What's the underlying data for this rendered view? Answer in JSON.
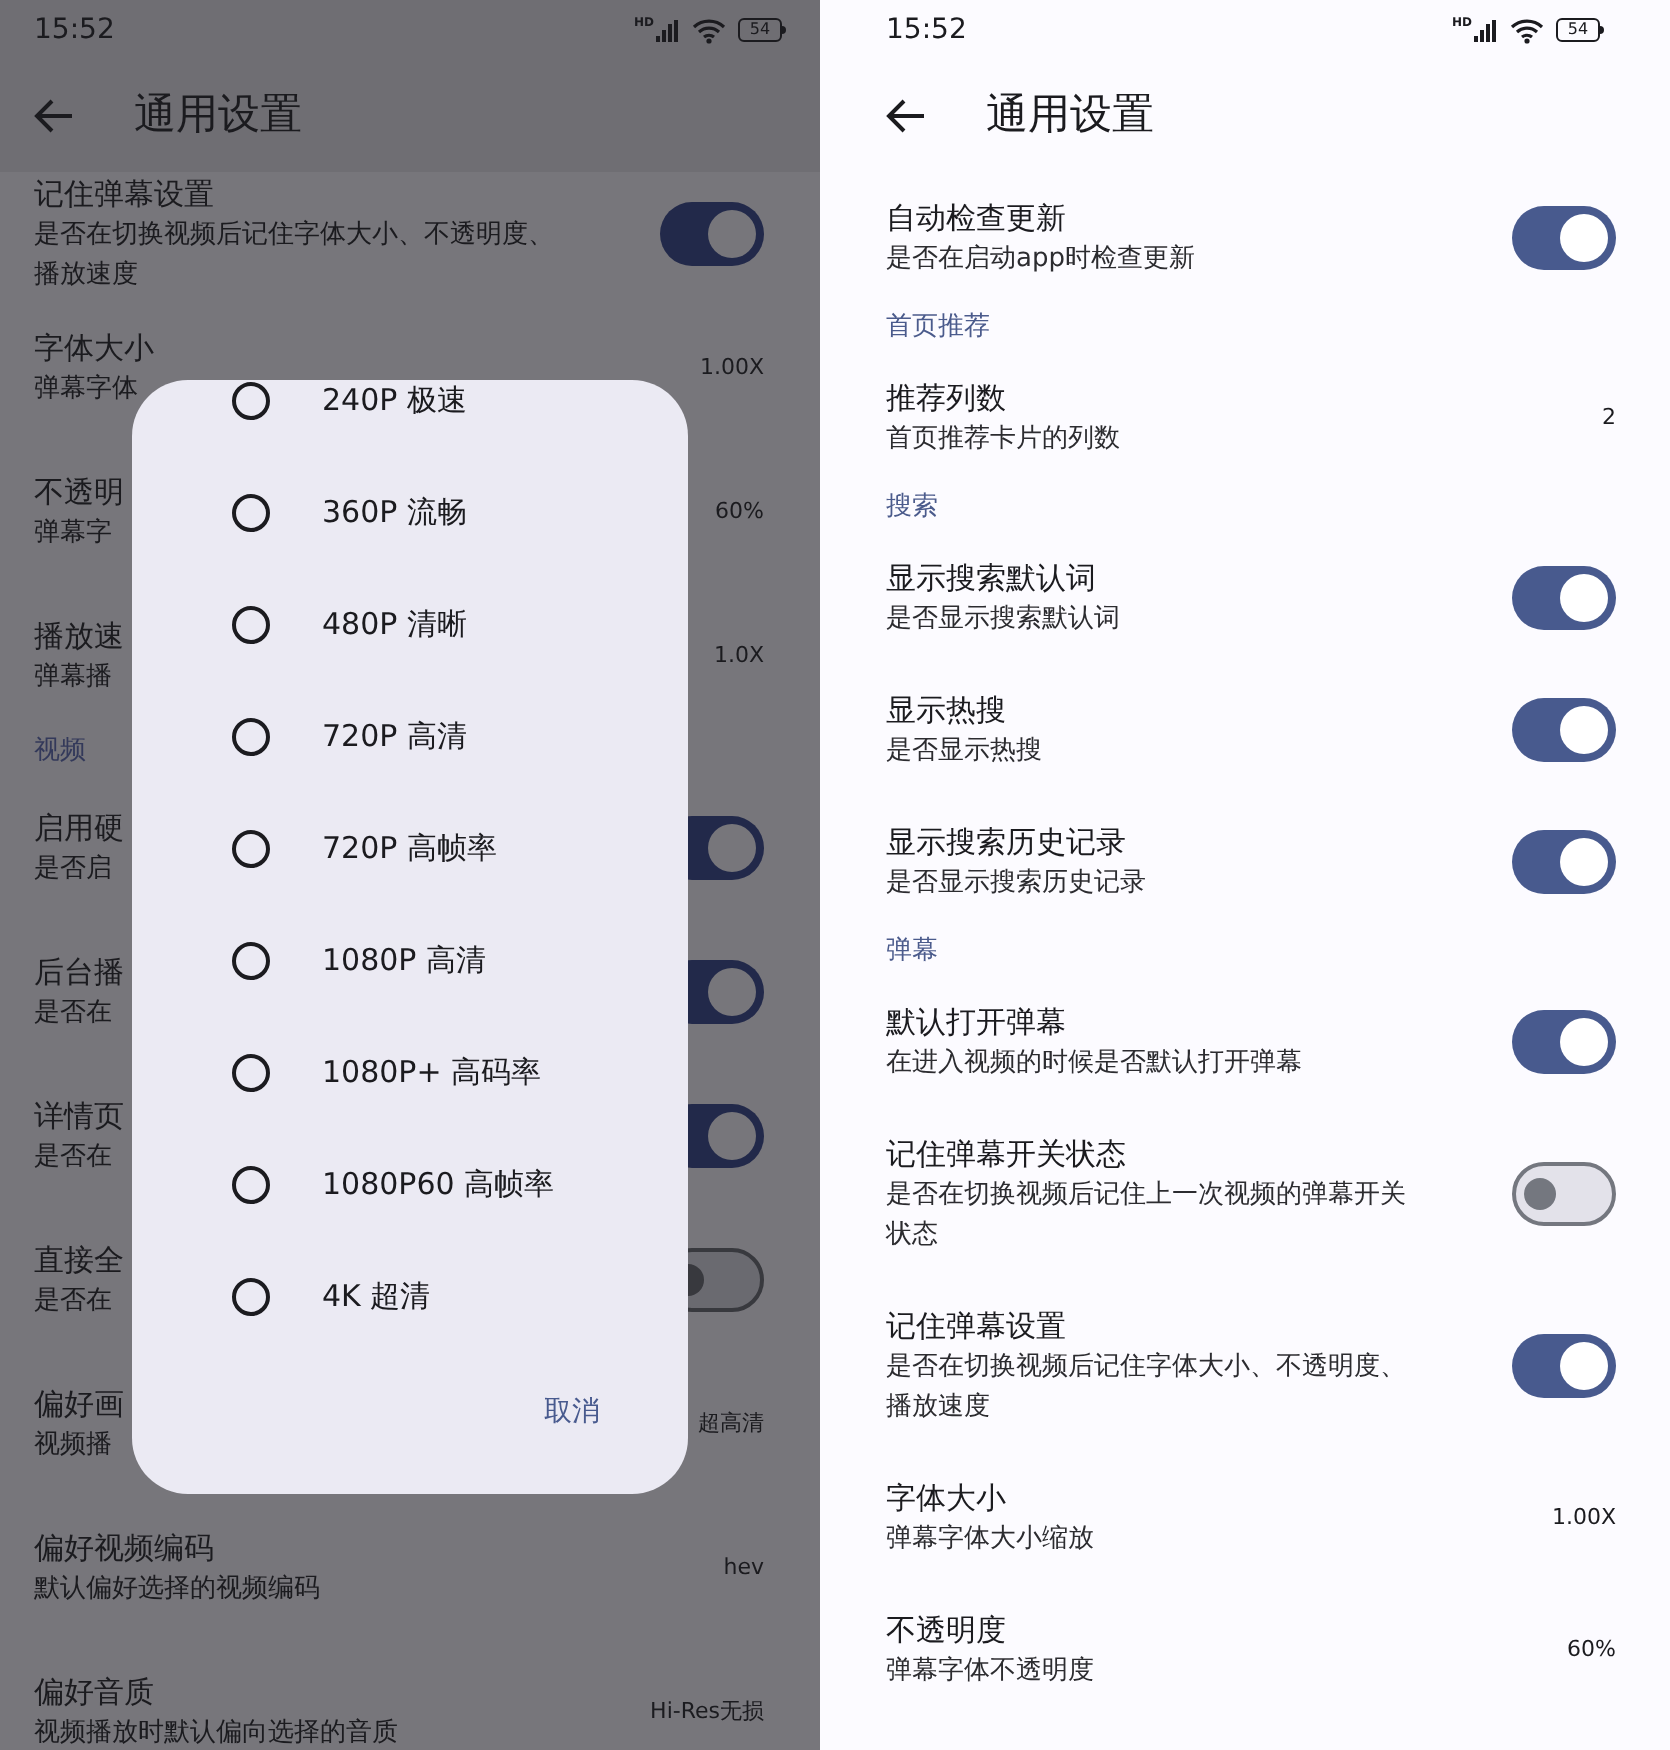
{
  "left_screen": {
    "status_bar": {
      "time": "15:52",
      "signal_label": "HD",
      "battery": "54"
    },
    "title": "通用设置",
    "items": [
      {
        "kind": "toggle",
        "title": "记住弹幕设置",
        "subtitle": "是否在切换视频后记住字体大小、不透明度、播放速度",
        "on": true
      },
      {
        "kind": "value",
        "title": "字体大小",
        "subtitle": "弹幕字体",
        "value": "1.00X"
      },
      {
        "kind": "value",
        "title": "不透明",
        "subtitle": "弹幕字",
        "value": "60%"
      },
      {
        "kind": "value",
        "title": "播放速",
        "subtitle": "弹幕播",
        "value": "1.0X"
      },
      {
        "kind": "section",
        "title": "视频"
      },
      {
        "kind": "toggle",
        "title": "启用硬",
        "subtitle": "是否启",
        "on": true
      },
      {
        "kind": "toggle",
        "title": "后台播",
        "subtitle": "是否在",
        "on": true
      },
      {
        "kind": "toggle",
        "title": "详情页",
        "subtitle": "是否在",
        "on": true
      },
      {
        "kind": "toggle",
        "title": "直接全",
        "subtitle": "是否在",
        "on": false
      },
      {
        "kind": "value",
        "title": "偏好画",
        "subtitle": "视频播",
        "value": "超高清"
      },
      {
        "kind": "value",
        "title": "偏好视频编码",
        "subtitle": "默认偏好选择的视频编码",
        "value": "hev"
      },
      {
        "kind": "value",
        "title": "偏好音质",
        "subtitle": "视频播放时默认偏向选择的音质",
        "value": "Hi-Res无损"
      }
    ],
    "dialog": {
      "options": [
        {
          "label": "240P 极速",
          "selected": false
        },
        {
          "label": "360P 流畅",
          "selected": false
        },
        {
          "label": "480P 清晰",
          "selected": false
        },
        {
          "label": "720P 高清",
          "selected": false
        },
        {
          "label": "720P 高帧率",
          "selected": false
        },
        {
          "label": "1080P 高清",
          "selected": false
        },
        {
          "label": "1080P+ 高码率",
          "selected": false
        },
        {
          "label": "1080P60 高帧率",
          "selected": false
        },
        {
          "label": "4K 超清",
          "selected": false
        }
      ],
      "cancel": "取消"
    }
  },
  "right_screen": {
    "status_bar": {
      "time": "15:52",
      "signal_label": "HD",
      "battery": "54"
    },
    "title": "通用设置",
    "items": [
      {
        "kind": "toggle",
        "title": "自动检查更新",
        "subtitle": "是否在启动app时检查更新",
        "on": true
      },
      {
        "kind": "section",
        "title": "首页推荐"
      },
      {
        "kind": "value",
        "title": "推荐列数",
        "subtitle": "首页推荐卡片的列数",
        "value": "2"
      },
      {
        "kind": "section",
        "title": "搜索"
      },
      {
        "kind": "toggle",
        "title": "显示搜索默认词",
        "subtitle": "是否显示搜索默认词",
        "on": true
      },
      {
        "kind": "toggle",
        "title": "显示热搜",
        "subtitle": "是否显示热搜",
        "on": true
      },
      {
        "kind": "toggle",
        "title": "显示搜索历史记录",
        "subtitle": "是否显示搜索历史记录",
        "on": true
      },
      {
        "kind": "section",
        "title": "弹幕"
      },
      {
        "kind": "toggle",
        "title": "默认打开弹幕",
        "subtitle": "在进入视频的时候是否默认打开弹幕",
        "on": true
      },
      {
        "kind": "toggle",
        "title": "记住弹幕开关状态",
        "subtitle": "是否在切换视频后记住上一次视频的弹幕开关状态",
        "on": false
      },
      {
        "kind": "toggle",
        "title": "记住弹幕设置",
        "subtitle": "是否在切换视频后记住字体大小、不透明度、播放速度",
        "on": true
      },
      {
        "kind": "value",
        "title": "字体大小",
        "subtitle": "弹幕字体大小缩放",
        "value": "1.00X"
      },
      {
        "kind": "value",
        "title": "不透明度",
        "subtitle": "弹幕字体不透明度",
        "value": "60%"
      }
    ]
  }
}
